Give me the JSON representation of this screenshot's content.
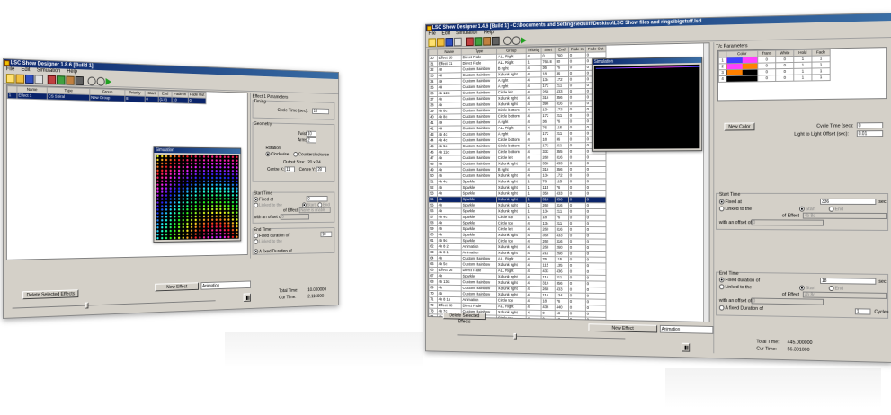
{
  "app_title_small": "LSC Show Designer 1.8.6 [Build 1]",
  "app_title_large": "LSC Show Designer 1.4.6 [Build 1] - C:\\Documents and Settings\\eduliff\\Desktop\\LSC Show files and rings\\bigstuff.lsd",
  "menu": [
    "File",
    "Edit",
    "Simulation",
    "Help"
  ],
  "simulation_title": "Simulation",
  "small": {
    "columns": [
      "Name",
      "Type",
      "Group",
      "Priority",
      "Start",
      "End",
      "Fade In",
      "Fade Out"
    ],
    "rows": [
      {
        "num": "1",
        "name": "Effect 1",
        "type": "CS Spiral",
        "group": "New Group",
        "priority": "8",
        "start": "0",
        "end": "(1:0)",
        "fadein": "10",
        "fadeout": "0"
      }
    ],
    "effect_params_title": "Effect 1 Parameters",
    "timing_label": "Timing",
    "cycle_time_label": "Cycle Time (sec):",
    "cycle_time_value": "10",
    "geometry_label": "Geometry",
    "twist_label": "Twist:",
    "twist_value": "10",
    "arms_label": "Arms:",
    "arms_value": "2",
    "rotation_label": "Rotation",
    "clockwise_label": "Clockwise",
    "counterclockwise_label": "Counterclockwise",
    "output_size_label": "Output Size:",
    "output_size_value": "20 x 24",
    "centre_x_label": "Centre X:",
    "centre_x_value": "11",
    "centre_y_label": "Centre Y:",
    "centre_y_value": "28",
    "start_time_label": "Start Time",
    "fixed_at_label": "Fixed at",
    "fixed_at_value": "0",
    "linked_to_label": "Linked to the",
    "start_label": "Start",
    "end_label": "End",
    "of_effect_label": "of Effect",
    "of_effect_value": "Name is unable",
    "offset_label": "with an offset of",
    "offset_value": "0",
    "end_time_label": "End Time",
    "fixed_duration_label": "Fixed duration of",
    "fixed_duration_value": "10",
    "linked_label2": "Linked to the",
    "fixed_duration2_label": "A fixed Duration of",
    "delete_button": "Delete Selected Effects",
    "new_effect_button": "New Effect",
    "animation_select": "Animation",
    "total_time_label": "Total Time:",
    "total_time_value": "10.000000",
    "cur_time_label": "Cur Time:",
    "cur_time_value": "2.116000"
  },
  "large": {
    "columns": [
      "",
      "Name",
      "Type",
      "Group",
      "Priority",
      "Start",
      "End",
      "Fade In",
      "Fade Out"
    ],
    "rows": [
      {
        "num": "30",
        "name": "Effect 28",
        "type": "Direct Fade",
        "group": "ALL Right",
        "priority": "4",
        "start": "0",
        "end": "760",
        "fadein": "0",
        "fadeout": "0"
      },
      {
        "num": "31",
        "name": "Effect 31",
        "type": "Direct Fade",
        "group": "ALL Right",
        "priority": "1",
        "start": "760.8",
        "end": "80",
        "fadein": "0",
        "fadeout": "0"
      },
      {
        "num": "32",
        "name": "40",
        "type": "Custom Rainbow",
        "group": "B right",
        "priority": "4",
        "start": "36",
        "end": "76",
        "fadein": "0",
        "fadeout": "0"
      },
      {
        "num": "33",
        "name": "40",
        "type": "Custom Rainbow",
        "group": "Xdrunk right",
        "priority": "4",
        "start": "18",
        "end": "36",
        "fadein": "0",
        "fadeout": "0"
      },
      {
        "num": "34",
        "name": "49",
        "type": "Custom Rainbow",
        "group": "A right",
        "priority": "4",
        "start": "134",
        "end": "172",
        "fadein": "0",
        "fadeout": "0"
      },
      {
        "num": "35",
        "name": "49",
        "type": "Custom Rainbow",
        "group": "A right",
        "priority": "4",
        "start": "172",
        "end": "211",
        "fadein": "0",
        "fadeout": "0"
      },
      {
        "num": "36",
        "name": "4b 12c",
        "type": "Custom Rainbow",
        "group": "Circle left",
        "priority": "4",
        "start": "268",
        "end": "433",
        "fadein": "0",
        "fadeout": "0"
      },
      {
        "num": "37",
        "name": "4b",
        "type": "Custom Rainbow",
        "group": "Xdrunk right",
        "priority": "4",
        "start": "316",
        "end": "356",
        "fadein": "0",
        "fadeout": "0"
      },
      {
        "num": "38",
        "name": "4b",
        "type": "Custom Rainbow",
        "group": "Xdrunk right",
        "priority": "4",
        "start": "396",
        "end": "316",
        "fadein": "0",
        "fadeout": "0"
      },
      {
        "num": "39",
        "name": "4b 8c",
        "type": "Custom Rainbow",
        "group": "Circle bottom",
        "priority": "4",
        "start": "134",
        "end": "172",
        "fadein": "0",
        "fadeout": "0"
      },
      {
        "num": "40",
        "name": "4b 8c",
        "type": "Custom Rainbow",
        "group": "Circle bottom",
        "priority": "4",
        "start": "172",
        "end": "211",
        "fadein": "0",
        "fadeout": "0"
      },
      {
        "num": "41",
        "name": "49",
        "type": "Custom Rainbow",
        "group": "A right",
        "priority": "4",
        "start": "36",
        "end": "76",
        "fadein": "0",
        "fadeout": "0"
      },
      {
        "num": "42",
        "name": "49",
        "type": "Custom Rainbow",
        "group": "ALL Right",
        "priority": "4",
        "start": "76",
        "end": "115",
        "fadein": "0",
        "fadeout": "0"
      },
      {
        "num": "43",
        "name": "4b 4c",
        "type": "Custom Rainbow",
        "group": "A right",
        "priority": "4",
        "start": "172",
        "end": "211",
        "fadein": "0",
        "fadeout": "0"
      },
      {
        "num": "44",
        "name": "4b 4c",
        "type": "Custom Rainbow",
        "group": "Circle bottom",
        "priority": "4",
        "start": "18",
        "end": "36",
        "fadein": "0",
        "fadeout": "0"
      },
      {
        "num": "45",
        "name": "4b 5c",
        "type": "Custom Rainbow",
        "group": "Circle bottom",
        "priority": "4",
        "start": "172",
        "end": "211",
        "fadein": "0",
        "fadeout": "0"
      },
      {
        "num": "46",
        "name": "4b 11c",
        "type": "Custom Rainbow",
        "group": "Circle bottom",
        "priority": "4",
        "start": "333",
        "end": "355",
        "fadein": "0",
        "fadeout": "0"
      },
      {
        "num": "47",
        "name": "4b",
        "type": "Custom Rainbow",
        "group": "Circle left",
        "priority": "4",
        "start": "260",
        "end": "316",
        "fadein": "0",
        "fadeout": "0"
      },
      {
        "num": "48",
        "name": "4b",
        "type": "Custom Rainbow",
        "group": "Xdrunk right",
        "priority": "4",
        "start": "356",
        "end": "433",
        "fadein": "0",
        "fadeout": "0"
      },
      {
        "num": "49",
        "name": "4b",
        "type": "Custom Rainbow",
        "group": "B right",
        "priority": "4",
        "start": "316",
        "end": "356",
        "fadein": "0",
        "fadeout": "0"
      },
      {
        "num": "50",
        "name": "4b",
        "type": "Custom Rainbow",
        "group": "Xdrunk right",
        "priority": "4",
        "start": "134",
        "end": "172",
        "fadein": "0",
        "fadeout": "0"
      },
      {
        "num": "51",
        "name": "4b 4c",
        "type": "Sparkle",
        "group": "Xdrunk right",
        "priority": "1",
        "start": "76",
        "end": "115",
        "fadein": "0",
        "fadeout": "0"
      },
      {
        "num": "52",
        "name": "4b",
        "type": "Sparkle",
        "group": "Xdrunk right",
        "priority": "1",
        "start": "115",
        "end": "76",
        "fadein": "0",
        "fadeout": "0"
      },
      {
        "num": "53",
        "name": "4b",
        "type": "Sparkle",
        "group": "Xdrunk right",
        "priority": "1",
        "start": "356",
        "end": "433",
        "fadein": "0",
        "fadeout": "0"
      },
      {
        "num": "54",
        "name": "4b",
        "type": "Sparkle",
        "group": "Xdrunk right",
        "priority": "1",
        "start": "316",
        "end": "356",
        "fadein": "0",
        "fadeout": "0"
      },
      {
        "num": "55",
        "name": "4b",
        "type": "Sparkle",
        "group": "Xdrunk right",
        "priority": "1",
        "start": "260",
        "end": "316",
        "fadein": "0",
        "fadeout": "0"
      },
      {
        "num": "56",
        "name": "4b",
        "type": "Sparkle",
        "group": "Xdrunk right",
        "priority": "1",
        "start": "134",
        "end": "211",
        "fadein": "0",
        "fadeout": "0"
      },
      {
        "num": "57",
        "name": "4b 4c",
        "type": "Sparkle",
        "group": "Circle top",
        "priority": "1",
        "start": "18",
        "end": "76",
        "fadein": "0",
        "fadeout": "0"
      },
      {
        "num": "58",
        "name": "4b",
        "type": "Sparkle",
        "group": "Circle top",
        "priority": "4",
        "start": "134",
        "end": "211",
        "fadein": "0",
        "fadeout": "0"
      },
      {
        "num": "59",
        "name": "4b",
        "type": "Sparkle",
        "group": "Circle left",
        "priority": "4",
        "start": "260",
        "end": "316",
        "fadein": "0",
        "fadeout": "0"
      },
      {
        "num": "60",
        "name": "4b",
        "type": "Sparkle",
        "group": "Xdrunk right",
        "priority": "4",
        "start": "356",
        "end": "433",
        "fadein": "0",
        "fadeout": "0"
      },
      {
        "num": "61",
        "name": "4b 9c",
        "type": "Sparkle",
        "group": "Circle top",
        "priority": "4",
        "start": "260",
        "end": "316",
        "fadein": "0",
        "fadeout": "0"
      },
      {
        "num": "62",
        "name": "4b 8 2",
        "type": "Animation",
        "group": "Xdrunk right",
        "priority": "4",
        "start": "268",
        "end": "260",
        "fadein": "0",
        "fadeout": "0"
      },
      {
        "num": "63",
        "name": "4b 8 1",
        "type": "Animation",
        "group": "Xdrunk right",
        "priority": "4",
        "start": "211",
        "end": "268",
        "fadein": "0",
        "fadeout": "0"
      },
      {
        "num": "64",
        "name": "4b",
        "type": "Custom Rainbow",
        "group": "ALL Right",
        "priority": "4",
        "start": "76",
        "end": "115",
        "fadein": "0",
        "fadeout": "0"
      },
      {
        "num": "65",
        "name": "4b 5c",
        "type": "Custom Rainbow",
        "group": "Xdrunk right",
        "priority": "4",
        "start": "115",
        "end": "135",
        "fadein": "0",
        "fadeout": "0"
      },
      {
        "num": "66",
        "name": "Effect 26",
        "type": "Direct Fade",
        "group": "ALL Right",
        "priority": "4",
        "start": "433",
        "end": "436",
        "fadein": "0",
        "fadeout": "0"
      },
      {
        "num": "67",
        "name": "4b",
        "type": "Sparkle",
        "group": "Xdrunk right",
        "priority": "4",
        "start": "114",
        "end": "211",
        "fadein": "0",
        "fadeout": "0"
      },
      {
        "num": "68",
        "name": "4b 13c",
        "type": "Custom Rainbow",
        "group": "Xdrunk right",
        "priority": "4",
        "start": "316",
        "end": "356",
        "fadein": "0",
        "fadeout": "0"
      },
      {
        "num": "69",
        "name": "4b",
        "type": "Custom Rainbow",
        "group": "Xdrunk right",
        "priority": "4",
        "start": "268",
        "end": "433",
        "fadein": "0",
        "fadeout": "0"
      },
      {
        "num": "70",
        "name": "4b",
        "type": "Custom Rainbow",
        "group": "Xdrunk right",
        "priority": "4",
        "start": "114",
        "end": "134",
        "fadein": "0",
        "fadeout": "0"
      },
      {
        "num": "71",
        "name": "4b 8 1a",
        "type": "Animation",
        "group": "Circle top",
        "priority": "4",
        "start": "18",
        "end": "76",
        "fadein": "0",
        "fadeout": "0"
      },
      {
        "num": "72",
        "name": "Effect 68",
        "type": "Direct Fade",
        "group": "ALL Right",
        "priority": "4",
        "start": "436",
        "end": "440",
        "fadein": "0",
        "fadeout": "0"
      },
      {
        "num": "73",
        "name": "4b 7c",
        "type": "Custom Rainbow",
        "group": "Xdrunk right",
        "priority": "4",
        "start": "0",
        "end": "18",
        "fadein": "0",
        "fadeout": "0"
      },
      {
        "num": "74",
        "name": "4b",
        "type": "Animation",
        "group": "Circle top",
        "priority": "4",
        "start": "0",
        "end": "18",
        "fadein": "0",
        "fadeout": "0"
      },
      {
        "num": "75",
        "name": "4b 12c",
        "type": "Animation",
        "group": "Circle top",
        "priority": "4",
        "start": "394",
        "end": "396",
        "fadein": "0",
        "fadeout": "0"
      }
    ],
    "color_params_title": "T/c Parameters",
    "color_columns": [
      "",
      "Color",
      "Trans",
      "White",
      "Hold",
      "Fade"
    ],
    "color_rows": [
      {
        "n": "1",
        "c1": "#4040ff",
        "c2": "#ff40ff",
        "trans": "0",
        "white": "0",
        "hold": "1",
        "fade": "1"
      },
      {
        "n": "2",
        "c1": "#ff40ff",
        "c2": "#ff8000",
        "trans": "0",
        "white": "0",
        "hold": "1",
        "fade": "1"
      },
      {
        "n": "3",
        "c1": "#ff8000",
        "c2": "#000000",
        "trans": "0",
        "white": "0",
        "hold": "1",
        "fade": "1"
      },
      {
        "n": "4",
        "c1": "#000000",
        "c2": "#000000",
        "trans": "0",
        "white": "0",
        "hold": "1",
        "fade": "1"
      }
    ],
    "new_color_button": "New Color",
    "cycle_time_label": "Cycle Time (sec):",
    "cycle_time_value": "0",
    "light_offset_label": "Light to Light Offset (sec):",
    "light_offset_value": "0.01",
    "start_time_label": "Start Time",
    "fixed_at_label": "Fixed at",
    "fixed_at_value": "336",
    "sec_label": "sec",
    "linked_to_label": "Linked to the",
    "start_label": "Start",
    "end_label": "End",
    "of_effect_label": "of Effect",
    "of_effect_value": "4b 8c",
    "offset_label": "with an offset of",
    "offset_value": "0",
    "end_time_label": "End Time",
    "fixed_duration_label": "Fixed duration of",
    "fixed_duration_value": "18",
    "linked_to_label2": "Linked to the",
    "of_effect_value2": "4b 8c",
    "offset_value2": "0",
    "fixed_duration2_label": "A fixed Duration of",
    "cycles_value": "1",
    "cycles_label": "Cycles",
    "delete_button": "Delete Selected Effects",
    "new_effect_button": "New Effect",
    "animation_select": "Animation",
    "total_time_label": "Total Time:",
    "total_time_value": "445.000000",
    "cur_time_label": "Cur Time:",
    "cur_time_value": "56.301000",
    "selected_row": 24
  }
}
